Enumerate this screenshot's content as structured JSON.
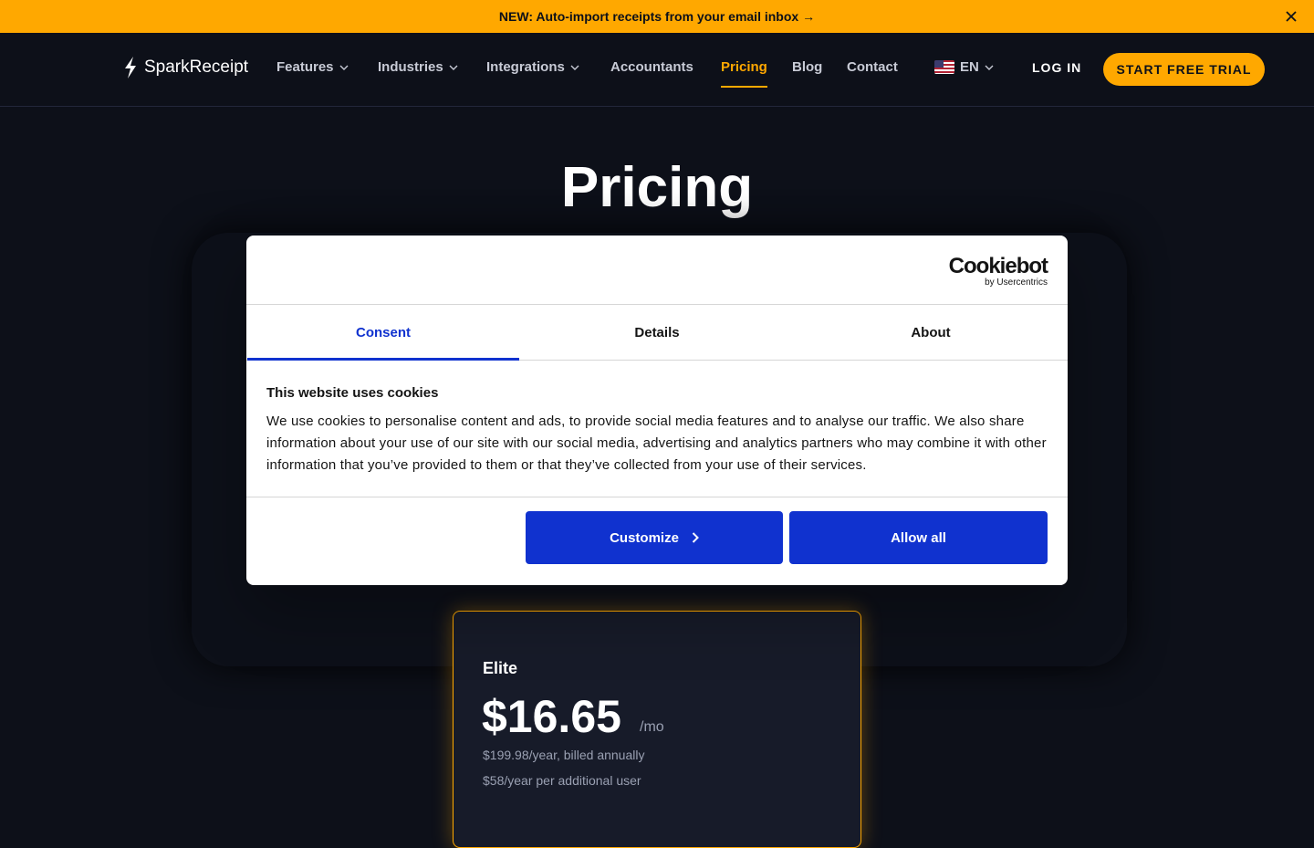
{
  "announcement": {
    "text": "NEW: Auto-import receipts from your email inbox →"
  },
  "header": {
    "logo_text": "SparkReceipt",
    "nav": [
      {
        "label": "Features",
        "has_dropdown": true
      },
      {
        "label": "Industries",
        "has_dropdown": true
      },
      {
        "label": "Integrations",
        "has_dropdown": true
      },
      {
        "label": "Accountants",
        "has_dropdown": false
      },
      {
        "label": "Pricing",
        "has_dropdown": false,
        "active": true
      },
      {
        "label": "Blog",
        "has_dropdown": false
      },
      {
        "label": "Contact",
        "has_dropdown": false
      }
    ],
    "language": "EN",
    "login_label": "LOG IN",
    "trial_label": "START FREE TRIAL"
  },
  "hero": {
    "title": "Pricing"
  },
  "plan": {
    "name": "Elite",
    "price": "$16.65",
    "unit": "/mo",
    "billed": "$199.98/year, billed annually",
    "extra_user": "$58/year per additional user"
  },
  "cookie_dialog": {
    "brand": "Cookiebot",
    "brand_sub": "by Usercentrics",
    "tabs": [
      {
        "label": "Consent",
        "active": true
      },
      {
        "label": "Details",
        "active": false
      },
      {
        "label": "About",
        "active": false
      }
    ],
    "heading": "This website uses cookies",
    "body": "We use cookies to personalise content and ads, to provide social media features and to analyse our traffic. We also share information about your use of our site with our social media, advertising and analytics partners who may combine it with other information that you’ve provided to them or that they’ve collected from your use of their services.",
    "customize_label": "Customize",
    "allow_all_label": "Allow all"
  },
  "colors": {
    "accent": "#ffa800",
    "background": "#0d1019",
    "cookie_primary": "#1032cf"
  }
}
